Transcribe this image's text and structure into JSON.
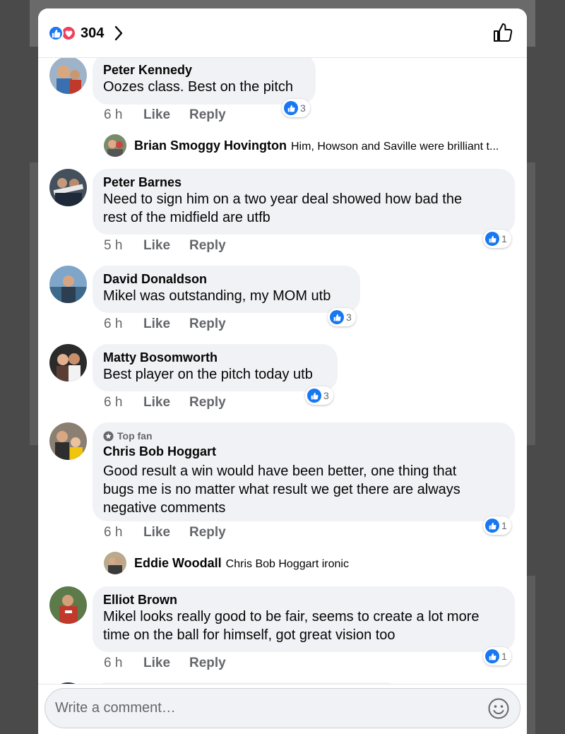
{
  "header": {
    "reaction_count": "304",
    "reactions": [
      "like-icon",
      "love-icon"
    ],
    "accent_like": "#1877f2",
    "accent_love": "#f33e58"
  },
  "comments": [
    {
      "author": "Peter Kennedy",
      "text": "Oozes class. Best on the pitch",
      "time": "6 h",
      "like_label": "Like",
      "reply_label": "Reply",
      "reaction_count": "3",
      "replies": [
        {
          "author": "Brian Smoggy Hovington",
          "text": "Him, Howson and Saville were brilliant t..."
        }
      ]
    },
    {
      "author": "Peter Barnes",
      "text_lines": [
        "Need to sign him on a two year deal showed how bad the",
        "rest of the midfield are utfb"
      ],
      "time": "5 h",
      "like_label": "Like",
      "reply_label": "Reply",
      "reaction_count": "1"
    },
    {
      "author": "David Donaldson",
      "text": "Mikel was outstanding, my MOM  utb",
      "time": "6 h",
      "like_label": "Like",
      "reply_label": "Reply",
      "reaction_count": "3"
    },
    {
      "author": "Matty Bosomworth",
      "text": "Best player on the pitch today utb",
      "time": "6 h",
      "like_label": "Like",
      "reply_label": "Reply",
      "reaction_count": "3"
    },
    {
      "badge": "Top fan",
      "author": "Chris Bob Hoggart",
      "text_lines": [
        "Good result a win would have been better, one thing that",
        "bugs me is no matter what result we get there are always",
        "negative comments"
      ],
      "time": "6 h",
      "like_label": "Like",
      "reply_label": "Reply",
      "reaction_count": "1",
      "replies": [
        {
          "author": "Eddie Woodall",
          "text": "Chris Bob Hoggart ironic"
        }
      ]
    },
    {
      "author": "Elliot Brown",
      "text_lines": [
        "Mikel looks really good to be fair, seems to create a lot more",
        "time on the ball for himself, got great vision too"
      ],
      "time": "6 h",
      "like_label": "Like",
      "reply_label": "Reply",
      "reaction_count": "1"
    }
  ],
  "composer": {
    "placeholder": "Write a comment…",
    "emoji_icon": "emoji-icon"
  }
}
